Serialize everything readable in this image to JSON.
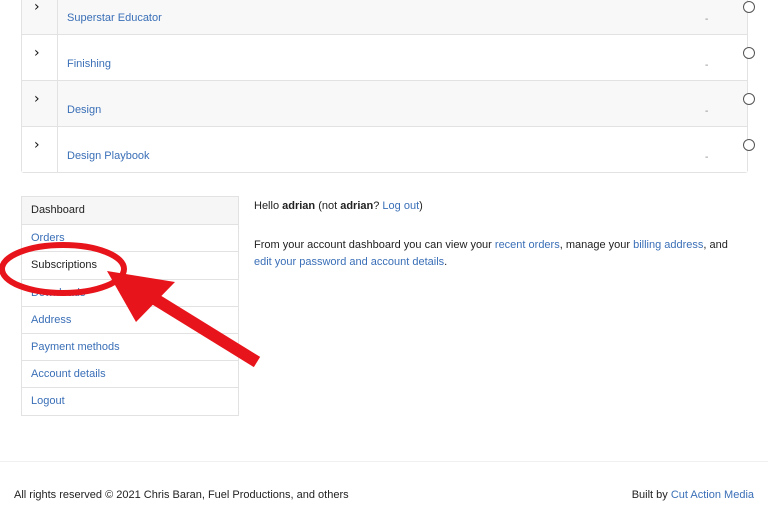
{
  "courses": [
    {
      "title": "Superstar Educator",
      "status": "-"
    },
    {
      "title": "Finishing",
      "status": "-"
    },
    {
      "title": "Design",
      "status": "-"
    },
    {
      "title": "Design Playbook",
      "status": "-"
    }
  ],
  "account_nav": {
    "items": [
      {
        "label": "Dashboard"
      },
      {
        "label": "Orders"
      },
      {
        "label": "Subscriptions"
      },
      {
        "label": "Downloads"
      },
      {
        "label": "Address"
      },
      {
        "label": "Payment methods"
      },
      {
        "label": "Account details"
      },
      {
        "label": "Logout"
      }
    ]
  },
  "greeting": {
    "hello": "Hello ",
    "username": "adrian",
    "not_prefix": " (not ",
    "not_username": "adrian",
    "not_suffix": "? ",
    "logout_link": "Log out",
    "close": ")"
  },
  "dashboard_text": {
    "part1": "From your account dashboard you can view your ",
    "recent_orders_link": "recent orders",
    "part2": ", manage your ",
    "billing_link": "billing address",
    "part3": ", and ",
    "password_link": "edit your password and account details",
    "part4": "."
  },
  "footer": {
    "copyright": "All rights reserved © 2021 Chris Baran, Fuel Productions, and others",
    "built_by_prefix": "Built by ",
    "built_by_link": "Cut Action Media"
  },
  "colors": {
    "link": "#3a6fb7",
    "annotation": "#e8141b"
  }
}
